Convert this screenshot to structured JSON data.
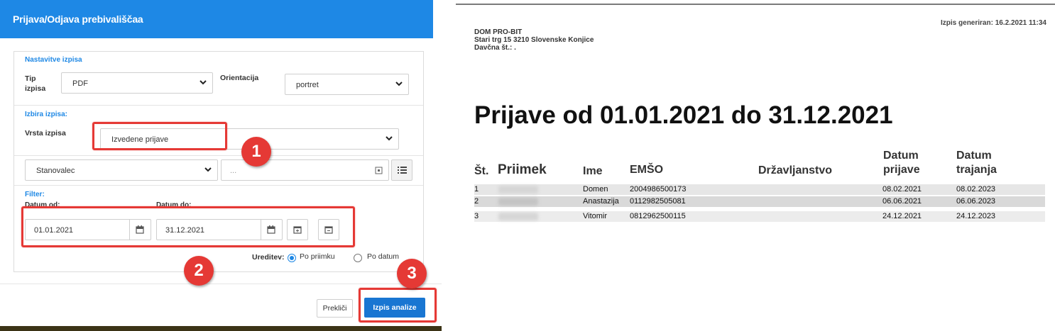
{
  "dialog": {
    "title": "Prijava/Odjava prebivališčaa",
    "settings": {
      "section_title": "Nastavitve izpisa",
      "type_label": "Tip izpisa",
      "type_value": "PDF",
      "orientation_label": "Orientacija",
      "orientation_value": "portret"
    },
    "selection": {
      "section_title": "Izbira izpisa:",
      "kind_label": "Vrsta izpisa",
      "kind_value": "Izvedene prijave",
      "resident_value": "Stanovalec",
      "search_placeholder": "..."
    },
    "filter": {
      "section_title": "Filter:",
      "date_from_label": "Datum od:",
      "date_from_value": "01.01.2021",
      "date_to_label": "Datum do:",
      "date_to_value": "31.12.2021",
      "sort_label": "Ureditev:",
      "sort_options": [
        "Po priimku",
        "Po datum"
      ],
      "sort_selected": "Po priimku"
    },
    "buttons": {
      "cancel": "Prekliči",
      "run": "Izpis analize"
    },
    "markers": [
      "1",
      "2",
      "3"
    ],
    "colors": {
      "header": "#1e88e5",
      "primary": "#1976d2",
      "marker": "#e53935"
    }
  },
  "report": {
    "generated": "Izpis generiran: 16.2.2021 11:34",
    "company": {
      "name": "DOM PRO-BIT",
      "address": "Stari trg 15 3210 Slovenske Konjice",
      "tax": "Davčna št.: ."
    },
    "title": "Prijave od 01.01.2021 do 31.12.2021",
    "columns": {
      "no": "Št.",
      "surname": "Priimek",
      "name": "Ime",
      "emso": "EMŠO",
      "citizenship": "Državljanstvo",
      "date_reg_1": "Datum",
      "date_reg_2": "prijave",
      "date_dur_1": "Datum",
      "date_dur_2": "trajanja"
    },
    "rows": [
      {
        "no": "1",
        "name": "Domen",
        "emso": "2004986500173",
        "date_reg": "08.02.2021",
        "date_dur": "08.02.2023"
      },
      {
        "no": "2",
        "name": "Anastazija",
        "emso": "0112982505081",
        "date_reg": "06.06.2021",
        "date_dur": "06.06.2023"
      },
      {
        "no": "3",
        "name": "Vitomir",
        "emso": "0812962500115",
        "date_reg": "24.12.2021",
        "date_dur": "24.12.2023"
      }
    ]
  }
}
